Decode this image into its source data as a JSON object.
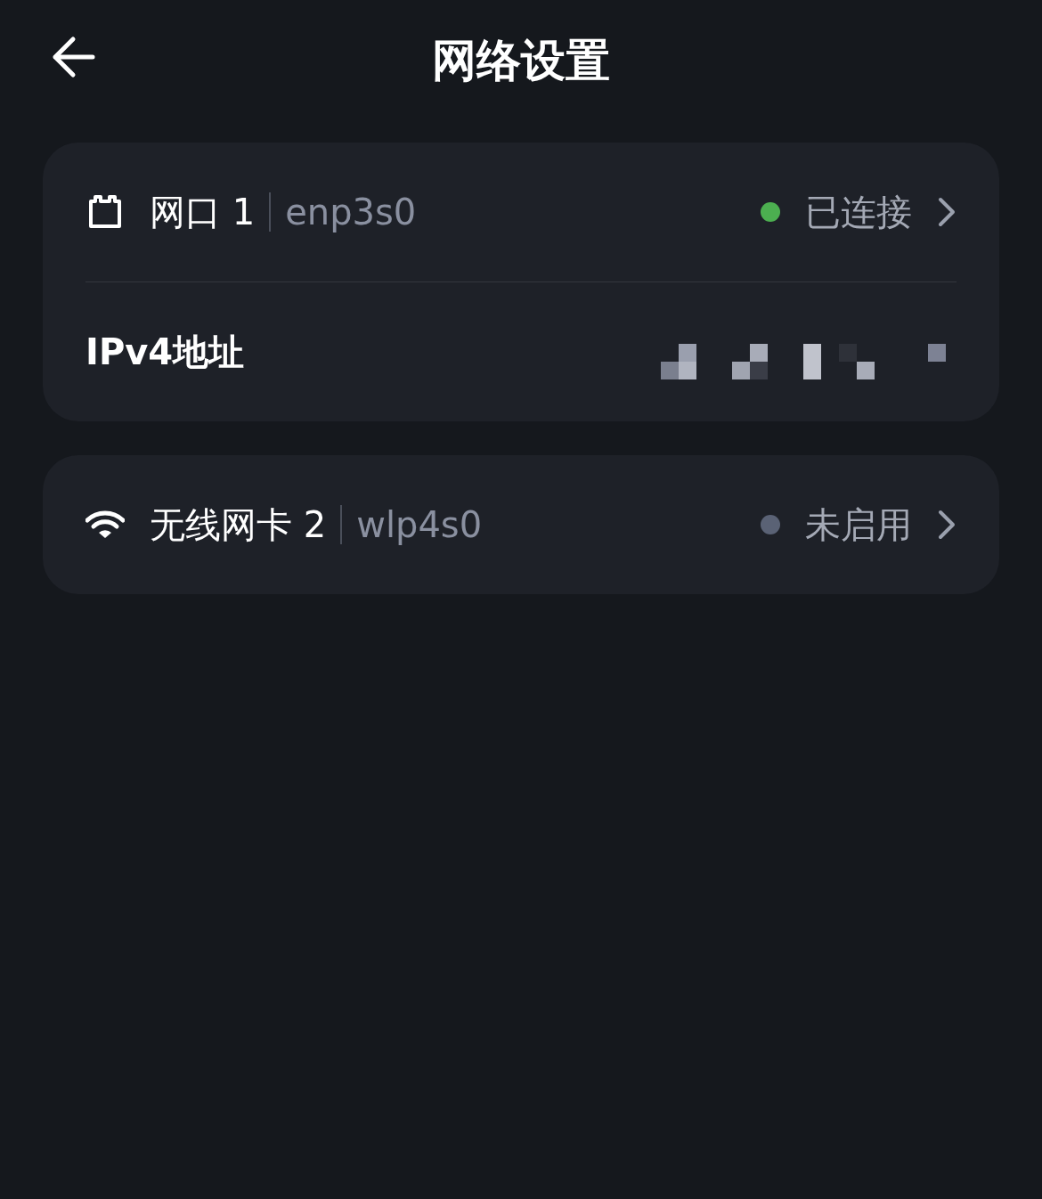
{
  "header": {
    "title": "网络设置"
  },
  "interfaces": [
    {
      "kind": "ethernet",
      "name": "网口 1",
      "device": "enp3s0",
      "status": "已连接",
      "color": "#4caf50",
      "ipv4": {
        "label": "IPv4地址"
      }
    },
    {
      "kind": "wifi",
      "name": "无线网卡 2",
      "device": "wlp4s0",
      "status": "未启用",
      "color": "#5a6275"
    }
  ]
}
